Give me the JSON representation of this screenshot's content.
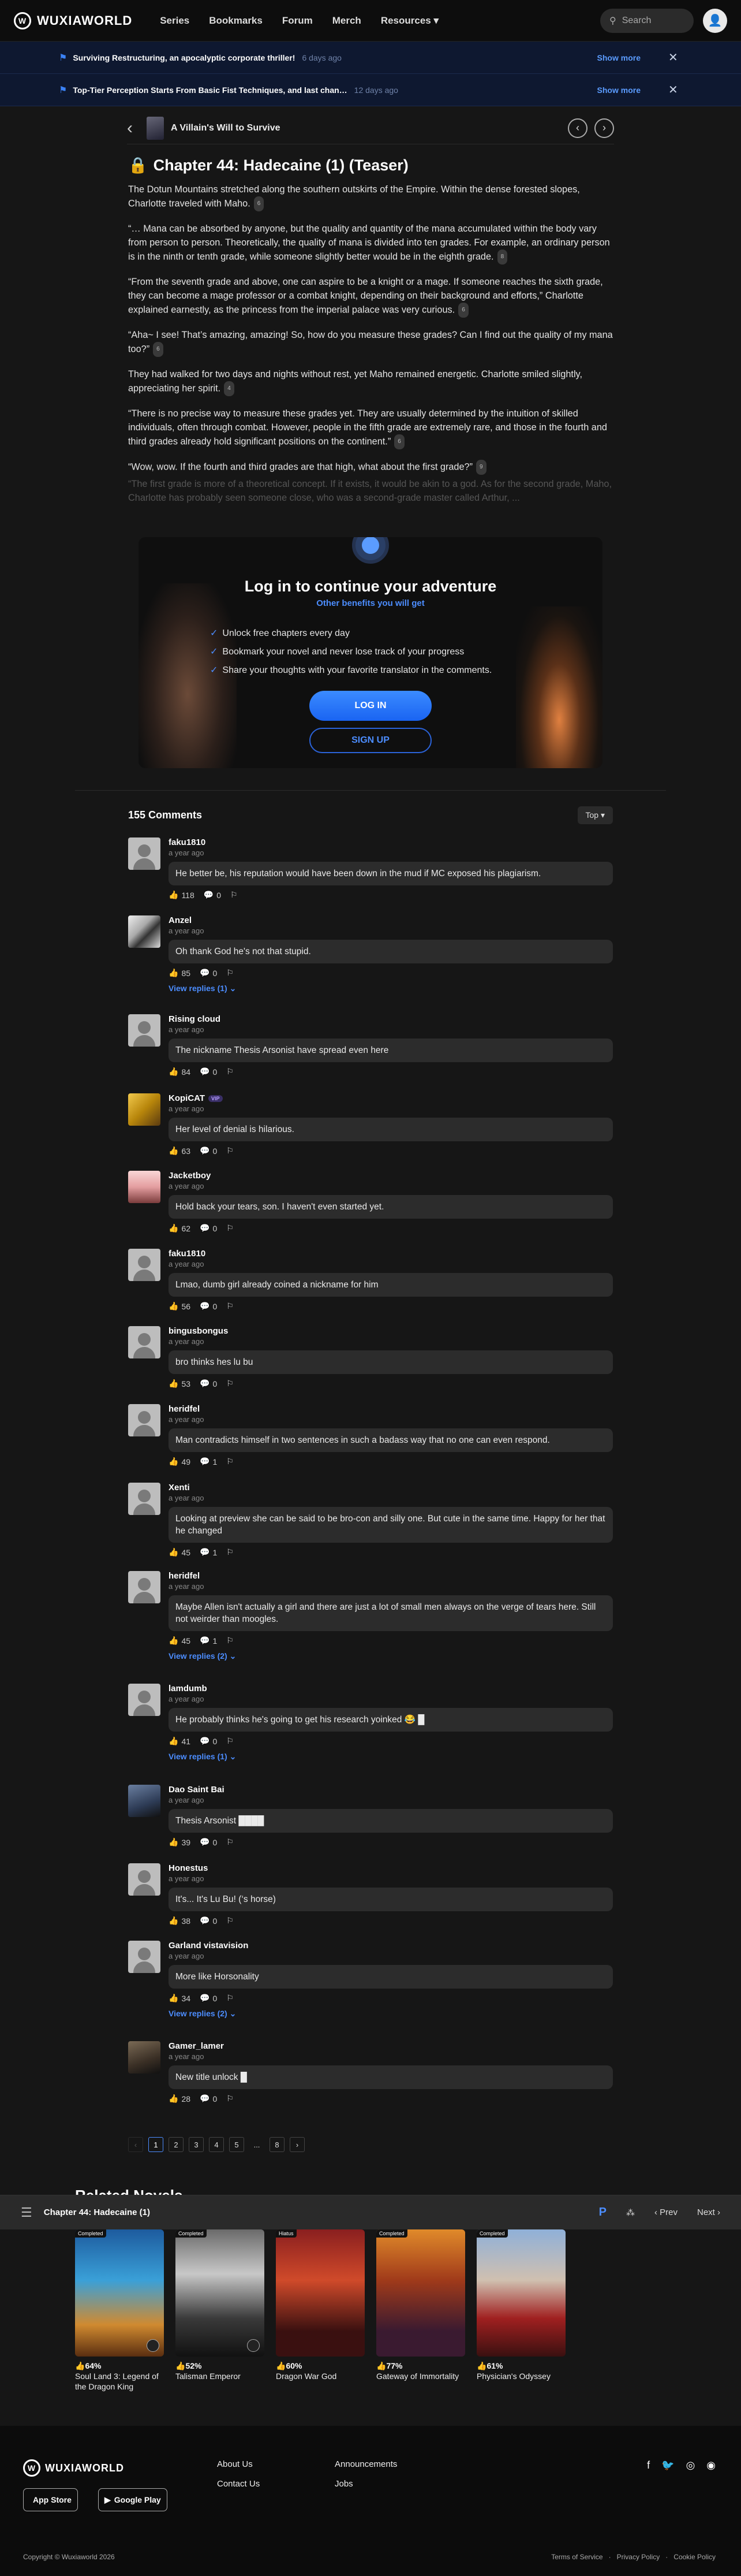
{
  "nav": {
    "logo": "WUXIAWORLD",
    "links": [
      "Series",
      "Bookmarks",
      "Forum",
      "Merch",
      "Resources"
    ],
    "search_placeholder": "Search"
  },
  "announcements": [
    {
      "title": "Surviving Restructuring, an apocalyptic corporate thriller!",
      "time": "6 days ago",
      "more": "Show more"
    },
    {
      "title": "Top-Tier Perception Starts From Basic Fist Techniques, and last chan…",
      "time": "12 days ago",
      "more": "Show more"
    }
  ],
  "chapter_bar": {
    "novel": "A Villain's Will to Survive"
  },
  "chapter": {
    "title": "Chapter 44: Hadecaine (1) (Teaser)",
    "paragraphs": [
      {
        "text": "The Dotun Mountains stretched along the southern outskirts of the Empire. Within the dense forested slopes, Charlotte traveled with Maho.",
        "c": "6"
      },
      {
        "text": "“… Mana can be absorbed by anyone, but the quality and quantity of the mana accumulated within the body vary from person to person. Theoretically, the quality of mana is divided into ten grades. For example, an ordinary person is in the ninth or tenth grade, while someone slightly better would be in the eighth grade.",
        "c": "8"
      },
      {
        "text": "“From the seventh grade and above, one can aspire to be a knight or a mage. If someone reaches the sixth grade, they can become a mage professor or a combat knight, depending on their background and efforts,” Charlotte explained earnestly, as the princess from the imperial palace was very curious.",
        "c": "6"
      },
      {
        "text": "“Aha~ I see! That’s amazing, amazing! So, how do you measure these grades? Can I find out the quality of my mana too?”",
        "c": "6"
      },
      {
        "text": "They had walked for two days and nights without rest, yet Maho remained energetic. Charlotte smiled slightly, appreciating her spirit.",
        "c": "4"
      },
      {
        "text": "“There is no precise way to measure these grades yet. They are usually determined by the intuition of skilled individuals, often through combat. However, people in the fifth grade are extremely rare, and those in the fourth and third grades already hold significant positions on the continent.”",
        "c": "6"
      },
      {
        "text": "“Wow, wow. If the fourth and third grades are that high, what about the first grade?”",
        "c": "9"
      }
    ],
    "faded": "“The first grade is more of a theoretical concept. If it exists, it would be akin to a god. As for the second grade, Maho, Charlotte has probably seen someone close, who was a second-grade master called Arthur, ..."
  },
  "login": {
    "title": "Log in to continue your adventure",
    "benefits_link": "Other benefits you will get",
    "items": [
      "Unlock free chapters every day",
      "Bookmark your novel and never lose track of your progress",
      "Share your thoughts with your favorite translator in the comments."
    ],
    "login": "LOG IN",
    "signup": "SIGN UP"
  },
  "comments_header": {
    "count": "155 Comments",
    "sort": "Top"
  },
  "comments": [
    {
      "user": "faku1810",
      "when": "a year ago",
      "text": "He better be, his reputation would have been down in the mud if MC exposed his plagiarism.",
      "likes": "118",
      "replies_n": "0",
      "avatar": "default"
    },
    {
      "user": "Anzel",
      "when": "a year ago",
      "text": "Oh thank God he's not that stupid.",
      "likes": "85",
      "replies_n": "0",
      "view": "View replies (1)",
      "avatar": "pic1"
    },
    {
      "user": "Rising cloud",
      "when": "a year ago",
      "text": "The nickname Thesis Arsonist have spread even here",
      "likes": "84",
      "replies_n": "0",
      "avatar": "default"
    },
    {
      "user": "KopiCAT",
      "vip": "VIP",
      "when": "a year ago",
      "text": "Her level of denial is hilarious.",
      "likes": "63",
      "replies_n": "0",
      "avatar": "pic2"
    },
    {
      "user": "Jacketboy",
      "when": "a year ago",
      "text": "Hold back your tears, son. I haven't even started yet.",
      "likes": "62",
      "replies_n": "0",
      "avatar": "pic3"
    },
    {
      "user": "faku1810",
      "when": "a year ago",
      "text": "Lmao, dumb girl already coined a nickname for him",
      "likes": "56",
      "replies_n": "0",
      "avatar": "default"
    },
    {
      "user": "bingusbongus",
      "when": "a year ago",
      "text": "bro thinks hes lu bu",
      "likes": "53",
      "replies_n": "0",
      "avatar": "default"
    },
    {
      "user": "heridfel",
      "when": "a year ago",
      "text": "Man contradicts himself in two sentences in such a badass way that no one can even respond.",
      "likes": "49",
      "replies_n": "1",
      "avatar": "default"
    },
    {
      "user": "Xenti",
      "when": "a year ago",
      "text": "Looking at preview she can be said to be bro-con and silly one. But cute in the same time. Happy for her that he changed",
      "likes": "45",
      "replies_n": "1",
      "avatar": "default"
    },
    {
      "user": "heridfel",
      "when": "a year ago",
      "text": "Maybe Allen isn't actually a girl and there are just a lot of small men always on the verge of tears here. Still not weirder than moogles.",
      "likes": "45",
      "replies_n": "1",
      "view": "View replies (2)",
      "avatar": "default"
    },
    {
      "user": "lamdumb",
      "when": "a year ago",
      "text": "He probably thinks he's going to get his research yoinked 😂 █",
      "likes": "41",
      "replies_n": "0",
      "view": "View replies (1)",
      "avatar": "default"
    },
    {
      "user": "Dao Saint Bai",
      "when": "a year ago",
      "text": "Thesis Arsonist ████",
      "likes": "39",
      "replies_n": "0",
      "avatar": "pic4"
    },
    {
      "user": "Honestus",
      "when": "a year ago",
      "text": "It's... It's Lu Bu! (‘s horse)",
      "likes": "38",
      "replies_n": "0",
      "avatar": "default"
    },
    {
      "user": "Garland vistavision",
      "when": "a year ago",
      "text": "More like Horsonality",
      "likes": "34",
      "replies_n": "0",
      "view": "View replies (2)",
      "avatar": "default"
    },
    {
      "user": "Gamer_lamer",
      "when": "a year ago",
      "text": "New title unlock █",
      "likes": "28",
      "replies_n": "0",
      "avatar": "pic5"
    }
  ],
  "pager": [
    "‹",
    "1",
    "2",
    "3",
    "4",
    "5",
    "...",
    "8",
    "›"
  ],
  "sticky": {
    "chapter": "Chapter 44: Hadecaine (1)",
    "prev": "Prev",
    "next": "Next"
  },
  "related": {
    "title": "Related Novels",
    "books": [
      {
        "pct": "64%",
        "name": "Soul Land 3: Legend of the Dragon King",
        "tag": "Completed"
      },
      {
        "pct": "52%",
        "name": "Talisman Emperor",
        "tag": "Completed"
      },
      {
        "pct": "60%",
        "name": "Dragon War God",
        "tag": "Hiatus"
      },
      {
        "pct": "77%",
        "name": "Gateway of Immortality",
        "tag": "Completed"
      },
      {
        "pct": "61%",
        "name": "Physician's Odyssey",
        "tag": "Completed"
      }
    ]
  },
  "footer": {
    "logo": "WUXIAWORLD",
    "appstore": "App Store",
    "googleplay": "Google Play",
    "col1": [
      "About Us",
      "Contact Us"
    ],
    "col2": [
      "Announcements",
      "Jobs"
    ],
    "copyright": "Copyright © Wuxiaworld 2026",
    "legal": [
      "Terms of Service",
      "Privacy Policy",
      "Cookie Policy"
    ]
  }
}
